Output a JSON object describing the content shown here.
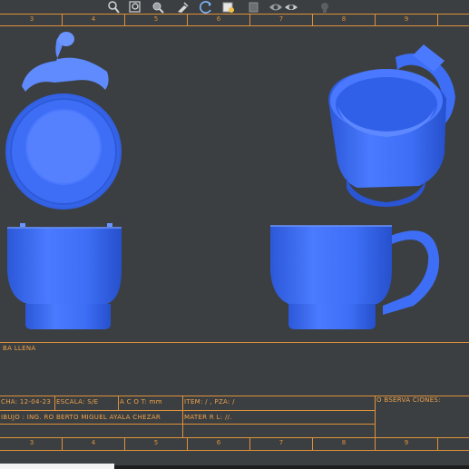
{
  "toolbar": {
    "icons": [
      "zoom-icon",
      "zoom-fit-icon",
      "zoom-window-icon",
      "pan-icon",
      "rotate-icon",
      "view-icon",
      "display-style-icon",
      "hide-show-icon",
      "appearance-icon"
    ]
  },
  "frame": {
    "zones_top": [
      "3",
      "4",
      "5",
      "6",
      "7",
      "8",
      "9"
    ],
    "zones_bottom": [
      "3",
      "4",
      "5",
      "6",
      "7",
      "8",
      "9"
    ]
  },
  "title_block": {
    "part_name": "BA LLENA",
    "fecha": "CHA: 12-04-23",
    "escala": "ESCALA: S/E",
    "acot": "A C O T: mm",
    "item": "ITEM: / , PZA: /",
    "observaciones": "O BSERVA CIONES:",
    "dibujo": "IBUJO : ING. RO BERTO MIGUEL AYALA CHEZAR",
    "material": "MATER R L: //."
  },
  "colors": {
    "background": "#3b3f41",
    "frame": "#e0913a",
    "part": "#3d6ef5"
  }
}
